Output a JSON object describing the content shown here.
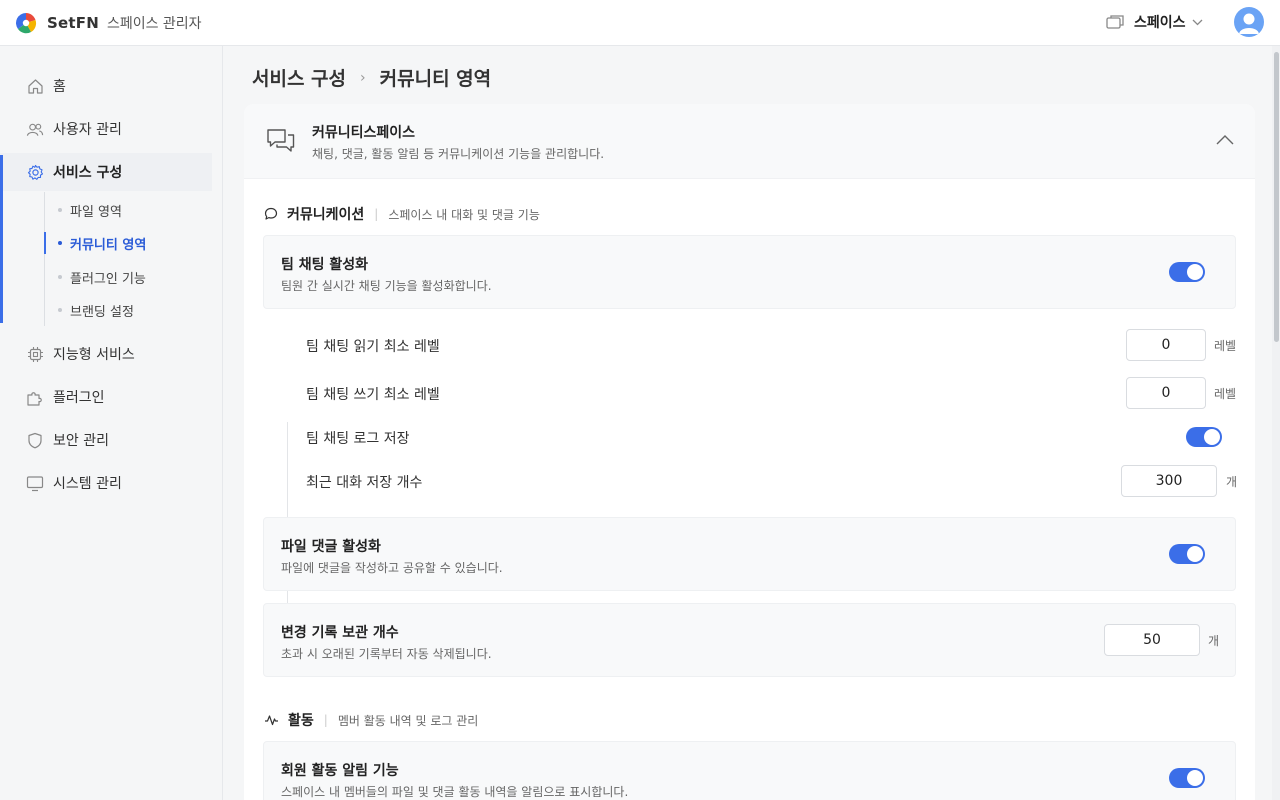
{
  "header": {
    "brand": "SetFN",
    "subtitle": "스페이스 관리자",
    "space_label": "스페이스"
  },
  "sidebar": {
    "items": [
      {
        "label": "홈",
        "icon": "home-icon"
      },
      {
        "label": "사용자 관리",
        "icon": "users-icon"
      },
      {
        "label": "서비스 구성",
        "icon": "gear-icon"
      },
      {
        "label": "지능형 서비스",
        "icon": "chip-icon"
      },
      {
        "label": "플러그인",
        "icon": "puzzle-icon"
      },
      {
        "label": "보안 관리",
        "icon": "shield-icon"
      },
      {
        "label": "시스템 관리",
        "icon": "monitor-icon"
      }
    ],
    "sub_items": [
      {
        "label": "파일 영역"
      },
      {
        "label": "커뮤니티 영역"
      },
      {
        "label": "플러그인 기능"
      },
      {
        "label": "브랜딩 설정"
      }
    ]
  },
  "breadcrumb": {
    "parent": "서비스 구성",
    "current": "커뮤니티 영역"
  },
  "card": {
    "title": "커뮤니티스페이스",
    "description": "채팅, 댓글, 활동 알림 등 커뮤니케이션 기능을 관리합니다."
  },
  "sections": {
    "communication": {
      "title": "커뮤니케이션",
      "description": "스페이스 내 대화 및 댓글 기능"
    },
    "activity": {
      "title": "활동",
      "description": "멤버 활동 내역 및 로그 관리"
    }
  },
  "settings": {
    "team_chat": {
      "title": "팀 채팅 활성화",
      "description": "팀원 간 실시간 채팅 기능을 활성화합니다.",
      "enabled": true
    },
    "read_level": {
      "label": "팀 채팅 읽기 최소 레벨",
      "value": "0",
      "unit": "레벨"
    },
    "write_level": {
      "label": "팀 채팅 쓰기 최소 레벨",
      "value": "0",
      "unit": "레벨"
    },
    "chat_log": {
      "label": "팀 채팅 로그 저장",
      "enabled": true
    },
    "recent_count": {
      "label": "최근 대화 저장 개수",
      "value": "300",
      "unit": "개"
    },
    "file_comment": {
      "title": "파일 댓글 활성화",
      "description": "파일에 댓글을 작성하고 공유할 수 있습니다.",
      "enabled": true
    },
    "history_count": {
      "title": "변경 기록 보관 개수",
      "description": "초과 시 오래된 기록부터 자동 삭제됩니다.",
      "value": "50",
      "unit": "개"
    },
    "activity_notify": {
      "title": "회원 활동 알림 기능",
      "description": "스페이스 내 멤버들의 파일 및 댓글 활동 내역을 알림으로 표시합니다.",
      "enabled": true
    }
  },
  "colors": {
    "accent": "#3b6ee8"
  }
}
